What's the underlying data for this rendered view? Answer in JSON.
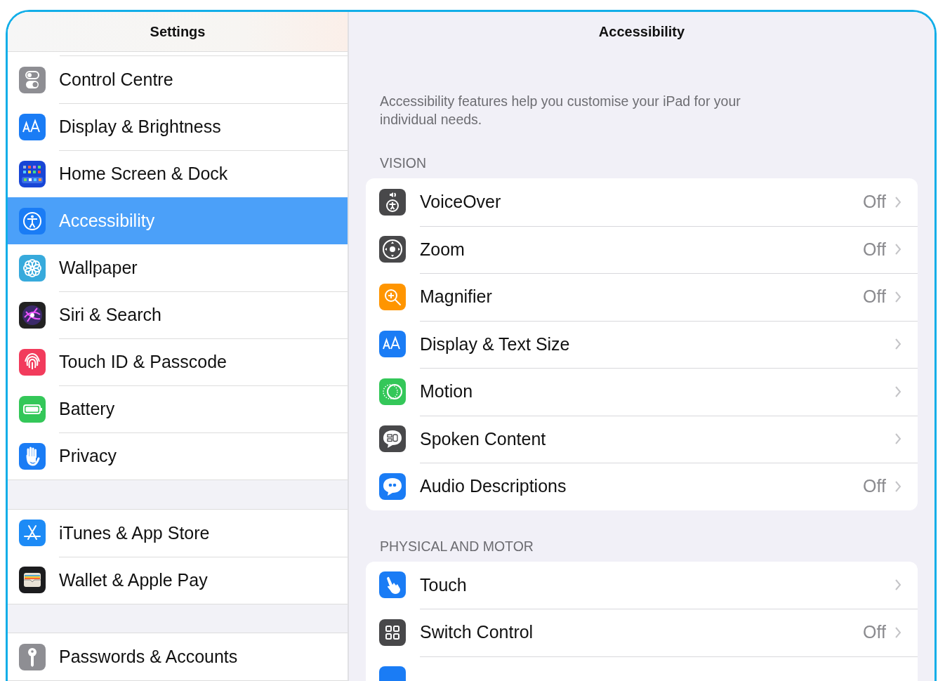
{
  "sidebar": {
    "title": "Settings",
    "groups": [
      {
        "items": [
          {
            "label": "Control Centre",
            "kind": "toggles",
            "selected": false
          },
          {
            "label": "Display & Brightness",
            "kind": "text-size",
            "selected": false
          },
          {
            "label": "Home Screen & Dock",
            "kind": "app-grid",
            "selected": false
          },
          {
            "label": "Accessibility",
            "kind": "accessibility",
            "selected": true
          },
          {
            "label": "Wallpaper",
            "kind": "flower",
            "selected": false
          },
          {
            "label": "Siri & Search",
            "kind": "orb",
            "selected": false
          },
          {
            "label": "Touch ID & Passcode",
            "kind": "fingerprint",
            "selected": false
          },
          {
            "label": "Battery",
            "kind": "battery",
            "selected": false
          },
          {
            "label": "Privacy",
            "kind": "hand",
            "selected": false
          }
        ]
      },
      {
        "items": [
          {
            "label": "iTunes & App Store",
            "kind": "letter-a",
            "selected": false
          },
          {
            "label": "Wallet & Apple Pay",
            "kind": "wallet",
            "selected": false
          }
        ]
      },
      {
        "items": [
          {
            "label": "Passwords & Accounts",
            "kind": "key",
            "selected": false
          }
        ]
      }
    ]
  },
  "detail": {
    "title": "Accessibility",
    "description": "Accessibility features help you customise your iPad for your individual needs.",
    "sections": [
      {
        "header": "VISION",
        "items": [
          {
            "label": "VoiceOver",
            "kind": "speaker-person",
            "value": "Off"
          },
          {
            "label": "Zoom",
            "kind": "target",
            "value": "Off"
          },
          {
            "label": "Magnifier",
            "kind": "magnifier",
            "value": "Off"
          },
          {
            "label": "Display & Text Size",
            "kind": "text-size"
          },
          {
            "label": "Motion",
            "kind": "circles"
          },
          {
            "label": "Spoken Content",
            "kind": "speech-bubble"
          },
          {
            "label": "Audio Descriptions",
            "kind": "quote-bubble",
            "value": "Off"
          }
        ]
      },
      {
        "header": "PHYSICAL AND MOTOR",
        "items": [
          {
            "label": "Touch",
            "kind": "pointing-hand"
          },
          {
            "label": "Switch Control",
            "kind": "grid",
            "value": "Off"
          },
          {
            "kind": "blank-blue"
          }
        ]
      }
    ]
  }
}
